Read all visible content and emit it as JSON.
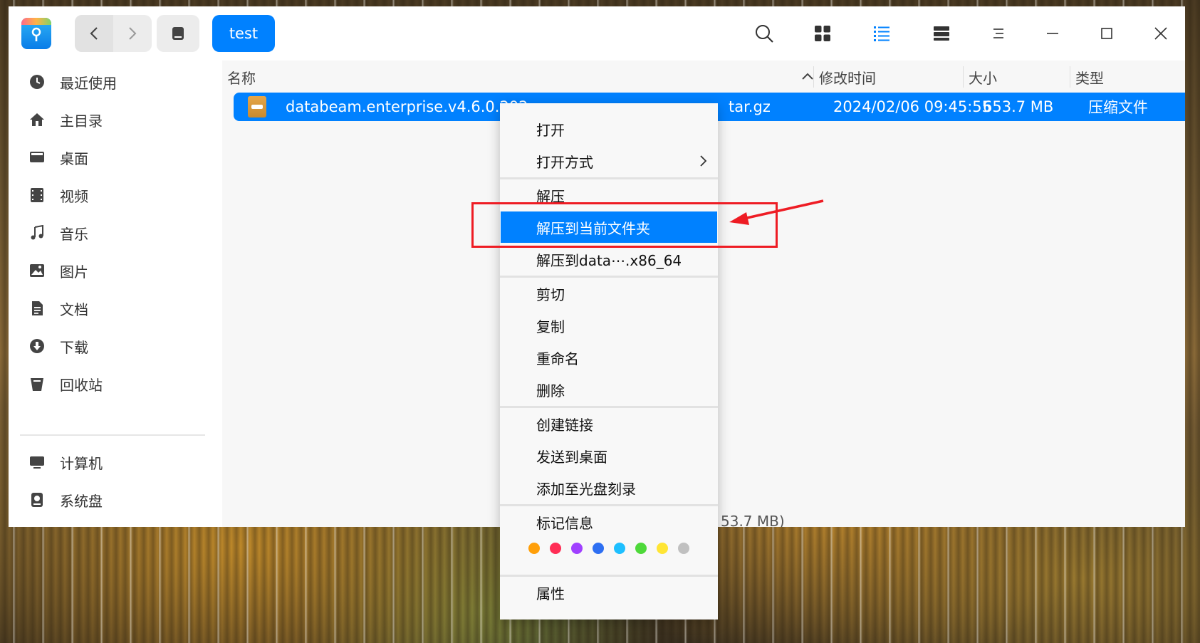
{
  "titlebar": {
    "breadcrumb": "test"
  },
  "sidebar": {
    "items": [
      {
        "label": "最近使用",
        "icon": "clock-icon"
      },
      {
        "label": "主目录",
        "icon": "home-icon"
      },
      {
        "label": "桌面",
        "icon": "desktop-icon"
      },
      {
        "label": "视频",
        "icon": "film-icon"
      },
      {
        "label": "音乐",
        "icon": "music-icon"
      },
      {
        "label": "图片",
        "icon": "image-icon"
      },
      {
        "label": "文档",
        "icon": "document-icon"
      },
      {
        "label": "下载",
        "icon": "download-icon"
      },
      {
        "label": "回收站",
        "icon": "trash-icon"
      },
      {
        "label": "计算机",
        "icon": "monitor-icon"
      },
      {
        "label": "系统盘",
        "icon": "disk-icon"
      }
    ]
  },
  "columns": {
    "name": "名称",
    "modified": "修改时间",
    "size": "大小",
    "type": "类型"
  },
  "file": {
    "name_left": "databeam.enterprise.v4.6.0.202",
    "name_right": "tar.gz",
    "modified": "2024/02/06 09:45:55",
    "size": "653.7 MB",
    "type": "压缩文件"
  },
  "status": {
    "text": "53.7 MB)"
  },
  "context_menu": {
    "open": "打开",
    "open_with": "打开方式",
    "extract": "解压",
    "extract_here": "解压到当前文件夹",
    "extract_to": "解压到data⋯.x86_64",
    "cut": "剪切",
    "copy": "复制",
    "rename": "重命名",
    "delete": "删除",
    "create_link": "创建链接",
    "send_to_desktop": "发送到桌面",
    "add_to_disc": "添加至光盘刻录",
    "tag_info": "标记信息",
    "properties": "属性",
    "tag_colors": [
      "#ff9f0a",
      "#ff2d55",
      "#a040ff",
      "#2e6ff2",
      "#1ebfff",
      "#4ed93a",
      "#ffe534",
      "#c0c0c0"
    ]
  },
  "colors": {
    "accent": "#0081ff",
    "annotation": "#ee1c24"
  }
}
